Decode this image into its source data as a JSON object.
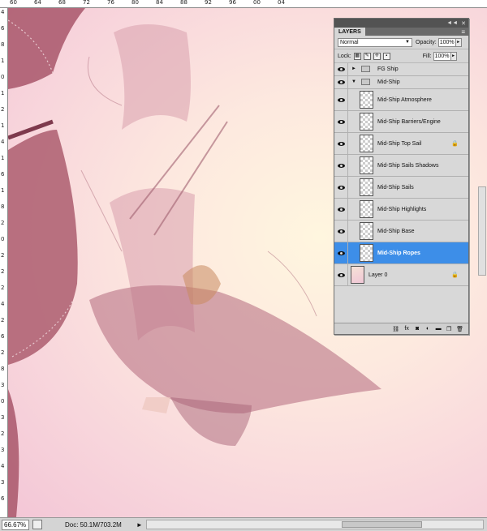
{
  "rulers": {
    "top_labels": [
      "60",
      "64",
      "68",
      "72",
      "76",
      "80",
      "84",
      "88",
      "92",
      "96",
      "00",
      "04"
    ],
    "left_labels": [
      "4",
      "6",
      "8",
      "1",
      "0",
      "1",
      "2",
      "1",
      "4",
      "1",
      "6",
      "1",
      "8",
      "2",
      "0",
      "2",
      "2",
      "2",
      "4",
      "2",
      "6",
      "2",
      "8",
      "3",
      "0",
      "3",
      "2",
      "3",
      "4",
      "3",
      "6"
    ]
  },
  "layers_panel": {
    "title_controls": [
      "◄◄",
      "✕"
    ],
    "tab_label": "LAYERS",
    "menu_icon": "≡",
    "blend_mode": "Normal",
    "opacity_label": "Opacity:",
    "opacity_value": "100%",
    "lock_label": "Lock:",
    "fill_label": "Fill:",
    "fill_value": "100%",
    "layers": [
      {
        "name": "FG Ship",
        "type": "group",
        "expanded": false,
        "lock": false,
        "selected": false
      },
      {
        "name": "Mid-Ship",
        "type": "group",
        "expanded": true,
        "lock": false,
        "selected": false
      },
      {
        "name": "Mid-Ship Atmosphere",
        "type": "layer",
        "lock": false,
        "selected": false
      },
      {
        "name": "Mid-Ship Barriers/Engine",
        "type": "layer",
        "lock": false,
        "selected": false
      },
      {
        "name": "Mid-Ship Top Sail",
        "type": "layer",
        "lock": true,
        "selected": false
      },
      {
        "name": "Mid-Ship Sails Shadows",
        "type": "layer",
        "lock": false,
        "selected": false
      },
      {
        "name": "Mid-Ship Sails",
        "type": "layer",
        "lock": false,
        "selected": false
      },
      {
        "name": "Mid-Ship Highlights",
        "type": "layer",
        "lock": false,
        "selected": false
      },
      {
        "name": "Mid-Ship Base",
        "type": "layer",
        "lock": false,
        "selected": false
      },
      {
        "name": "Mid-Ship Ropes",
        "type": "layer",
        "lock": false,
        "selected": true
      },
      {
        "name": "Layer 0",
        "type": "background",
        "lock": true,
        "selected": false
      }
    ],
    "footer_icons": [
      "link-icon",
      "fx-icon",
      "mask-icon",
      "adjustment-icon",
      "folder-icon",
      "new-layer-icon",
      "trash-icon"
    ],
    "footer_glyphs": [
      "⛓",
      "fx",
      "◙",
      "◐",
      "▬",
      "❐",
      "🗑"
    ]
  },
  "status_bar": {
    "zoom": "66.67%",
    "doc_size": "Doc: 50.1M/703.2M",
    "arrow": "►"
  },
  "colors": {
    "selection": "#3d8ee8",
    "panel_bg": "#d6d6d6",
    "canvas_pink": "#f3c6d6"
  }
}
